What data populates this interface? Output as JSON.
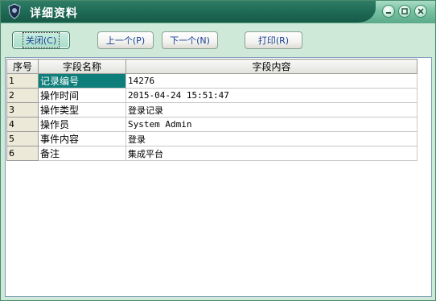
{
  "window": {
    "title": "详细资料",
    "buttons": {
      "minimize": "minimize-icon",
      "maximize": "maximize-icon",
      "close": "close-icon"
    }
  },
  "toolbar": {
    "close_label": "关闭(C)",
    "prev_label": "上一个(P)",
    "next_label": "下一个(N)",
    "print_label": "打印(R)"
  },
  "grid": {
    "headers": [
      "序号",
      "字段名称",
      "字段内容"
    ],
    "rows": [
      {
        "no": "1",
        "field": "记录编号",
        "value": "14276"
      },
      {
        "no": "2",
        "field": "操作时间",
        "value": "2015-04-24 15:51:47"
      },
      {
        "no": "3",
        "field": "操作类型",
        "value": "登录记录"
      },
      {
        "no": "4",
        "field": "操作员",
        "value": "System Admin"
      },
      {
        "no": "5",
        "field": "事件内容",
        "value": "登录"
      },
      {
        "no": "6",
        "field": "备注",
        "value": "集成平台"
      }
    ],
    "selected_row": 1
  },
  "colors": {
    "title_bar": "#1f6a55",
    "window_bg": "#cfe9d8",
    "selection": "#0e7e7a",
    "button_text": "#1a3f93"
  }
}
